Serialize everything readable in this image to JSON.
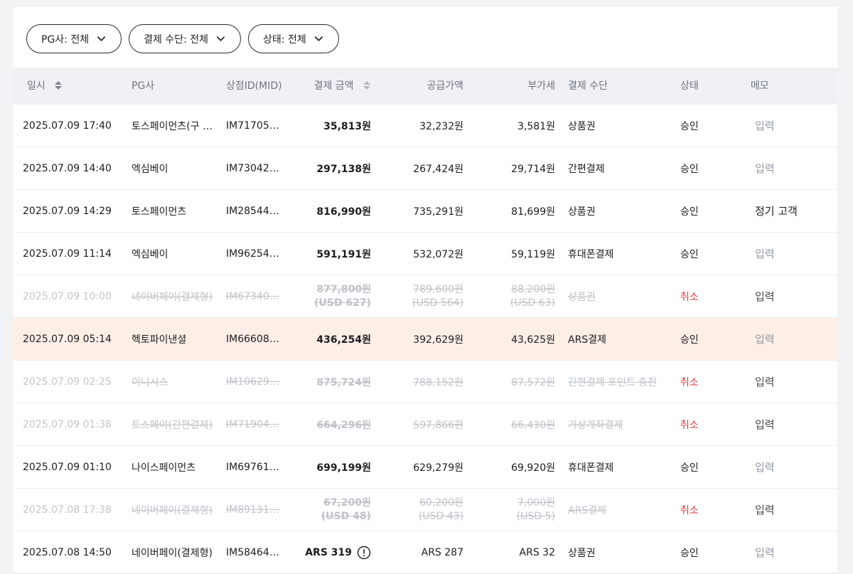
{
  "filters": [
    {
      "label": "PG사: 전체"
    },
    {
      "label": "결제 수단: 전체"
    },
    {
      "label": "상태: 전체"
    }
  ],
  "columns": {
    "date": "일시",
    "pg": "PG사",
    "mid": "상점ID(MID)",
    "amount": "결제 금액",
    "supply": "공급가액",
    "vat": "부가세",
    "method": "결제 수단",
    "status": "상태",
    "memo": "메모"
  },
  "rows": [
    {
      "date": "2025.07.09 17:40",
      "pg": "토스페이먼츠(구 …",
      "mid": "IM71705…",
      "amount": "35,813원",
      "supply": "32,232원",
      "vat": "3,581원",
      "method": "상품권",
      "status": "승인",
      "memo": "입력"
    },
    {
      "date": "2025.07.09 14:40",
      "pg": "엑심베이",
      "mid": "IM73042…",
      "amount": "297,138원",
      "supply": "267,424원",
      "vat": "29,714원",
      "method": "간편결제",
      "status": "승인",
      "memo": "입력"
    },
    {
      "date": "2025.07.09 14:29",
      "pg": "토스페이먼츠",
      "mid": "IM28544…",
      "amount": "816,990원",
      "supply": "735,291원",
      "vat": "81,699원",
      "method": "상품권",
      "status": "승인",
      "memo": "정기 고객"
    },
    {
      "date": "2025.07.09 11:14",
      "pg": "엑심베이",
      "mid": "IM96254…",
      "amount": "591,191원",
      "supply": "532,072원",
      "vat": "59,119원",
      "method": "휴대폰결제",
      "status": "승인",
      "memo": "입력"
    },
    {
      "date": "2025.07.09 10:00",
      "pg": "네이버페이(결제형)",
      "mid": "IM67340…",
      "amount": "877,800원",
      "amount_sub": "(USD 627)",
      "supply": "789,600원",
      "supply_sub": "(USD 564)",
      "vat": "88,200원",
      "vat_sub": "(USD 63)",
      "method": "상품권",
      "status": "취소",
      "memo": "입력"
    },
    {
      "date": "2025.07.09 05:14",
      "pg": "헥토파이낸셜",
      "mid": "IM66608…",
      "amount": "436,254원",
      "supply": "392,629원",
      "vat": "43,625원",
      "method": "ARS결제",
      "status": "승인",
      "memo": "입력"
    },
    {
      "date": "2025.07.09 02:25",
      "pg": "이니시스",
      "mid": "IM10629…",
      "amount": "875,724원",
      "supply": "788,152원",
      "vat": "87,572원",
      "method": "간편결제 포인트 충전",
      "status": "취소",
      "memo": "입력"
    },
    {
      "date": "2025.07.09 01:38",
      "pg": "토스페이(간편결제)",
      "mid": "IM71904…",
      "amount": "664,296원",
      "supply": "597,866원",
      "vat": "66,430원",
      "method": "가상계좌결제",
      "status": "취소",
      "memo": "입력"
    },
    {
      "date": "2025.07.09 01:10",
      "pg": "나이스페이먼츠",
      "mid": "IM69761…",
      "amount": "699,199원",
      "supply": "629,279원",
      "vat": "69,920원",
      "method": "휴대폰결제",
      "status": "승인",
      "memo": "입력"
    },
    {
      "date": "2025.07.08 17:38",
      "pg": "네이버페이(결제형)",
      "mid": "IM89131…",
      "amount": "67,200원",
      "amount_sub": "(USD 48)",
      "supply": "60,200원",
      "supply_sub": "(USD 43)",
      "vat": "7,000원",
      "vat_sub": "(USD 5)",
      "method": "ARS결제",
      "status": "취소",
      "memo": "입력"
    },
    {
      "date": "2025.07.08 14:50",
      "pg": "네이버페이(결제형)",
      "mid": "IM58464…",
      "amount": "ARS 319",
      "supply": "ARS 287",
      "vat": "ARS 32",
      "method": "상품권",
      "status": "승인",
      "memo": "입력"
    }
  ],
  "colors": {
    "cancel": "#e03a3a",
    "highlight_row": "#fdeee6",
    "header_bg": "#f0f1f4"
  },
  "icons": {
    "filter_chevron": "chevron-down-icon",
    "sort": "sort-icon",
    "alert": "alert-circle-icon"
  }
}
